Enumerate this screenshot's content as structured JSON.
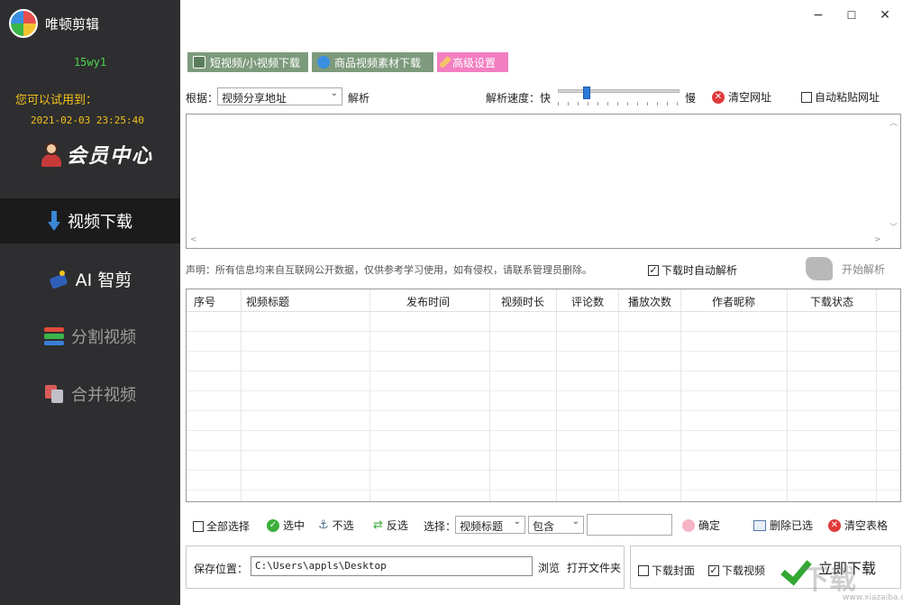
{
  "app": {
    "title": "唯顿剪辑"
  },
  "sidebar": {
    "user_id": "15wy1",
    "trial_label": "您可以试用到：",
    "trial_date": "2021-02-03 23:25:40",
    "member_center": "会员中心",
    "nav": [
      {
        "label": "视频下载",
        "icon": "download-arrow-icon",
        "active": true
      },
      {
        "label": "AI 智剪",
        "icon": "ai-edit-icon",
        "active": false
      },
      {
        "label": "分割视频",
        "icon": "split-video-icon",
        "active": false
      },
      {
        "label": "合并视频",
        "icon": "merge-video-icon",
        "active": false
      }
    ]
  },
  "window": {
    "minimize": "−",
    "maximize": "☐",
    "close": "✕"
  },
  "tabs": [
    {
      "label": "短视频/小视频下载",
      "color": "#7d9b7c"
    },
    {
      "label": "商品视频素材下载",
      "color": "#7d9b7c"
    },
    {
      "label": "高级设置",
      "color": "#f27ec1"
    }
  ],
  "parse": {
    "basis_label": "根据：",
    "basis_value": "视频分享地址",
    "parse_label": "解析",
    "speed_label": "解析速度：",
    "fast": "快",
    "slow": "慢",
    "speed_level": 0.22,
    "clear_url": "清空网址",
    "auto_paste": "自动粘贴网址",
    "auto_paste_checked": false
  },
  "declaration": {
    "text": "声明：所有信息均来自互联网公开数据，仅供参考学习使用，如有侵权，请联系管理员删除。",
    "auto_parse_on_download": "下载时自动解析",
    "auto_parse_checked": true,
    "start_parse": "开始解析"
  },
  "table": {
    "columns": [
      "序号",
      "视频标题",
      "发布时间",
      "视频时长",
      "评论数",
      "播放次数",
      "作者昵称",
      "下载状态"
    ],
    "rows": []
  },
  "toolbar": {
    "select_all": "全部选择",
    "select": "选中",
    "deselect": "不选",
    "invert": "反选",
    "choose_label": "选择：",
    "field_value": "视频标题",
    "match_value": "包含",
    "filter_text": "",
    "confirm": "确定",
    "delete_selected": "删除已选",
    "clear_table": "清空表格"
  },
  "save": {
    "label": "保存位置：",
    "path": "C:\\Users\\appls\\Desktop",
    "browse": "浏览",
    "open_folder": "打开文件夹",
    "download_cover": "下载封面",
    "download_cover_checked": false,
    "download_video": "下载视频",
    "download_video_checked": true,
    "download_now": "立即下载"
  },
  "watermark": {
    "text": "下载",
    "url": "www.xiazaiba.com"
  }
}
